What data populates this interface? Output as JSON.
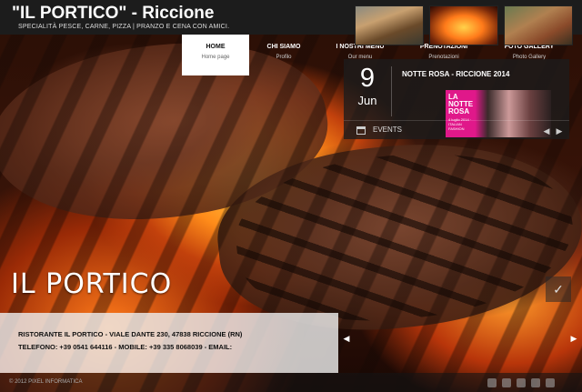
{
  "header": {
    "title": "\"IL PORTICO\" - Riccione",
    "tagline": "SPECIALITÀ PESCE, CARNE, PIZZA | PRANZO E CENA CON AMICI."
  },
  "nav": [
    {
      "label": "HOME",
      "sub": "Home page",
      "active": true
    },
    {
      "label": "CHI SIAMO",
      "sub": "Profilo"
    },
    {
      "label": "I NOSTRI MENÙ",
      "sub": "Our menu"
    },
    {
      "label": "PRENOTAZIONI",
      "sub": "Prenotazioni"
    },
    {
      "label": "FOTO GALLERY",
      "sub": "Photo Gallery"
    }
  ],
  "news": {
    "day": "9",
    "month": "Jun",
    "title": "NOTTE ROSA - RICCIONE 2014",
    "thumb_text": "LA NOTTE ROSA",
    "thumb_sub": "4 luglio 2014 · ITALIAN FASHION",
    "events_label": "EVENTS"
  },
  "hero": {
    "logo_text": "IL PORTICO"
  },
  "info": {
    "line1": "RISTORANTE IL PORTICO - VIALE DANTE 230, 47838 RICCIONE (RN)",
    "line2": "TELEFONO: +39 0541 644116 - MOBILE: +39 335 8068039 - EMAIL:"
  },
  "footer": {
    "copyright": "© 2012 PIXEL INFORMATICA"
  },
  "icons": {
    "check": "check-icon",
    "calendar": "calendar-icon"
  }
}
